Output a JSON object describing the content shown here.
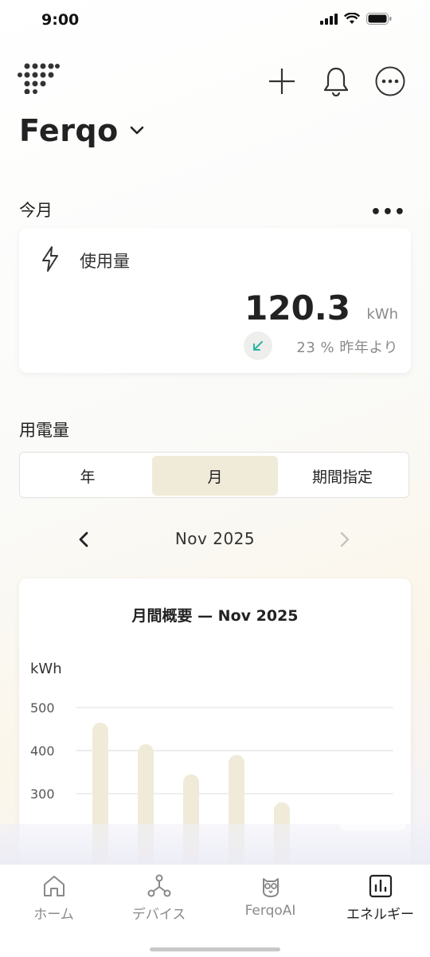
{
  "status_bar": {
    "time": "9:00"
  },
  "header": {
    "title": "Ferqo"
  },
  "this_month": {
    "section_label": "今月",
    "usage_label": "使用量",
    "value": "120.3",
    "unit": "kWh",
    "comparison_text": "23 % 昨年より"
  },
  "consumption": {
    "section_label": "用電量",
    "tabs": [
      "年",
      "月",
      "期間指定"
    ],
    "active_tab": "月",
    "period_label": "Nov 2025"
  },
  "chart": {
    "title": "月間概要 — Nov 2025",
    "y_unit": "kWh",
    "y_ticks": [
      "500",
      "400",
      "300"
    ]
  },
  "chart_data": {
    "type": "bar",
    "title": "月間概要 — Nov 2025",
    "ylabel": "kWh",
    "ylim": [
      200,
      520
    ],
    "values": [
      465,
      415,
      345,
      390,
      280
    ],
    "grid": true
  },
  "tabbar": {
    "items": [
      "ホーム",
      "デバイス",
      "FerqoAI",
      "エネルギー"
    ],
    "active": "エネルギー"
  },
  "colors": {
    "accent_bar": "#f0ebd9",
    "active_segment": "#f0ebd9",
    "arrow_teal": "#2bb5a0"
  }
}
